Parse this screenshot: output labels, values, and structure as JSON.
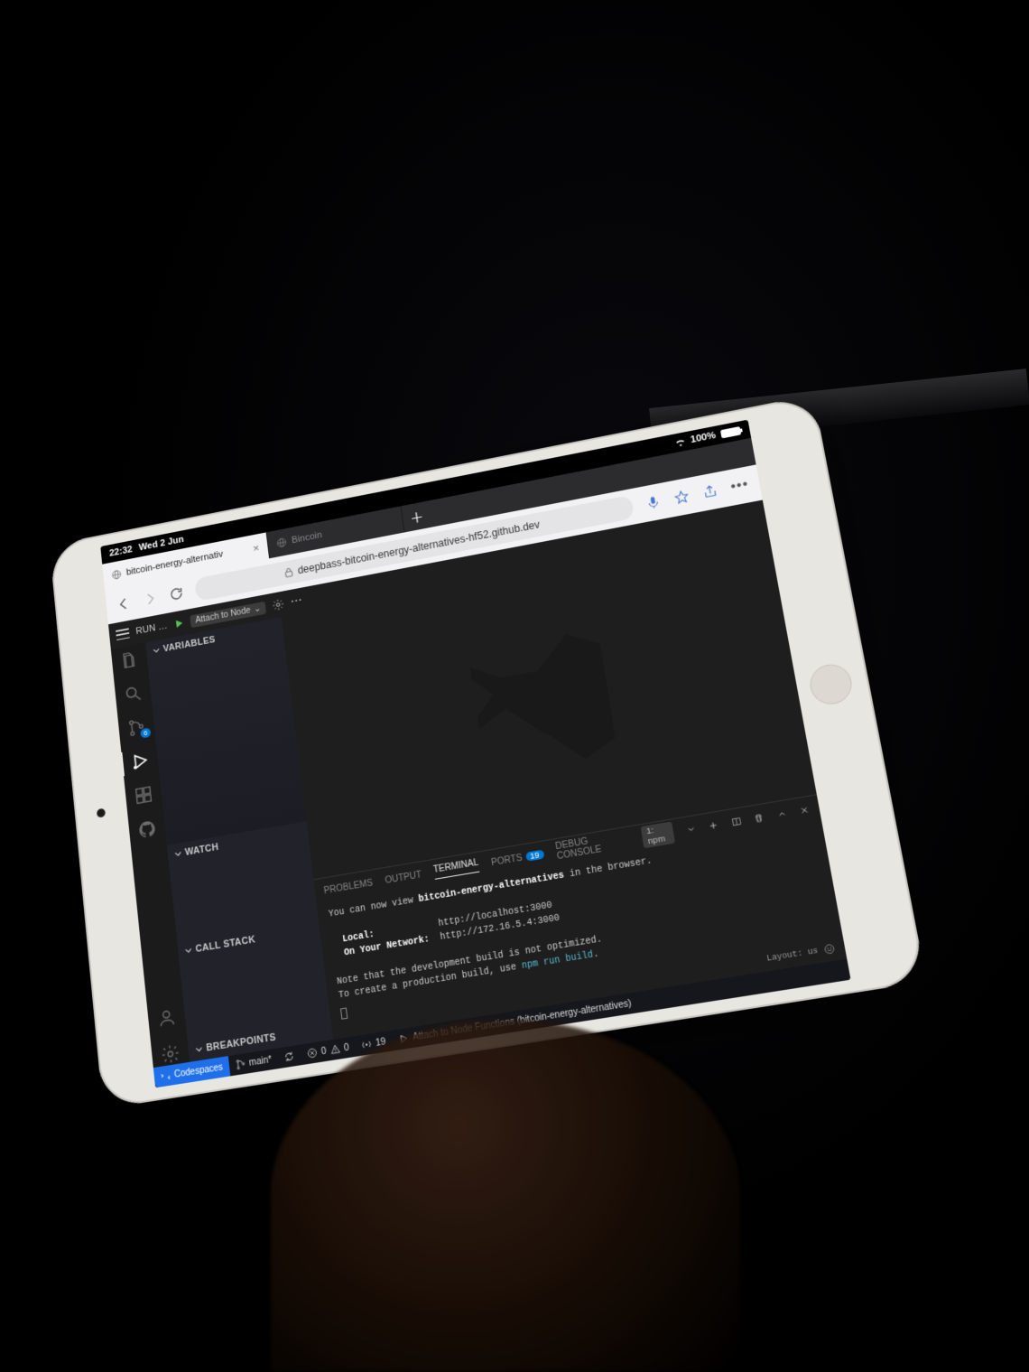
{
  "ios_status": {
    "time": "22:32",
    "date": "Wed 2 Jun",
    "battery": "100%"
  },
  "safari": {
    "tabs": [
      {
        "title": "bitcoin-energy-alternativ",
        "active": true
      },
      {
        "title": "Bincoin",
        "active": false
      }
    ],
    "url": "deepbass-bitcoin-energy-alternatives-hf52.github.dev"
  },
  "vscode": {
    "topbar": {
      "run_label": "RUN …",
      "config": "Attach to Node",
      "config_chevron": "⌄"
    },
    "debug_sections": {
      "variables": "VARIABLES",
      "watch": "WATCH",
      "callstack": "CALL STACK",
      "breakpoints": "BREAKPOINTS"
    },
    "source_control_badge": "6",
    "panel": {
      "tabs": {
        "problems": "PROBLEMS",
        "output": "OUTPUT",
        "terminal": "TERMINAL",
        "ports": "PORTS",
        "ports_count": "19",
        "debug_console": "DEBUG CONSOLE"
      },
      "terminal_selector": "1: npm",
      "terminal_lines": {
        "l1a": "You can now view ",
        "l1b": "bitcoin-energy-alternatives",
        "l1c": " in the browser.",
        "l2a": "Local:",
        "l2b": "http://localhost:3000",
        "l3a": "On Your Network:",
        "l3b": "http://172.16.5.4:3000",
        "l4": "Note that the development build is not optimized.",
        "l5a": "To create a production build, use ",
        "l5b": "npm run build",
        "l5c": "."
      },
      "layout_label": "Layout: us"
    },
    "statusbar": {
      "codespaces": "Codespaces",
      "branch": "main*",
      "errors": "0",
      "warnings": "0",
      "ports": "19",
      "debug_target": "Attach to Node Functions (bitcoin-energy-alternatives)"
    }
  }
}
